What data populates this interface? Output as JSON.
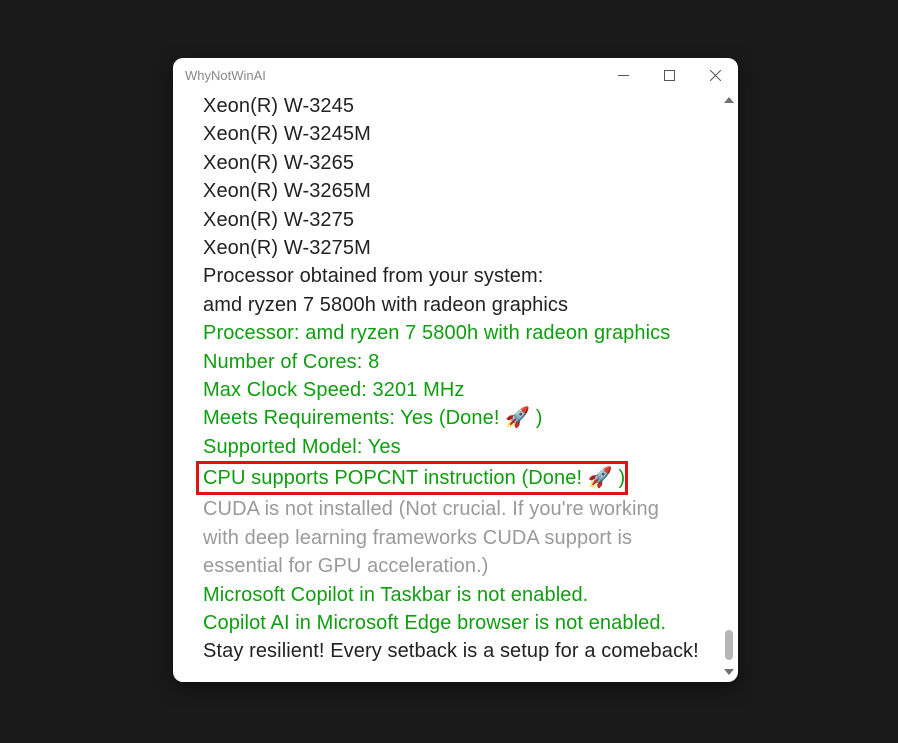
{
  "window": {
    "title": "WhyNotWinAI"
  },
  "lines": [
    {
      "cls": "black",
      "text": "Xeon(R) W-3245"
    },
    {
      "cls": "black",
      "text": "Xeon(R) W-3245M"
    },
    {
      "cls": "black",
      "text": "Xeon(R) W-3265"
    },
    {
      "cls": "black",
      "text": "Xeon(R) W-3265M"
    },
    {
      "cls": "black",
      "text": "Xeon(R) W-3275"
    },
    {
      "cls": "black",
      "text": "Xeon(R) W-3275M"
    },
    {
      "cls": "black",
      "text": "Processor obtained from your system:"
    },
    {
      "cls": "black",
      "text": "amd ryzen 7 5800h with radeon graphics"
    },
    {
      "cls": "green",
      "text": "Processor: amd ryzen 7 5800h with radeon graphics"
    },
    {
      "cls": "green",
      "text": "Number of Cores: 8"
    },
    {
      "cls": "green",
      "text": "Max Clock Speed: 3201 MHz"
    },
    {
      "cls": "green",
      "text": "Meets Requirements: Yes (Done! 🚀 )"
    },
    {
      "cls": "green",
      "text": "Supported Model: Yes"
    }
  ],
  "highlight": {
    "text": "CPU supports POPCNT instruction (Done! 🚀 )"
  },
  "tail": [
    {
      "cls": "gray",
      "text": "CUDA is not installed (Not crucial. If you're working with deep learning frameworks CUDA support is essential for GPU acceleration.)"
    },
    {
      "cls": "green",
      "text": "Microsoft Copilot in Taskbar is not enabled."
    },
    {
      "cls": "green",
      "text": "Copilot AI in Microsoft Edge browser is not enabled."
    },
    {
      "cls": "black",
      "text": "Stay resilient! Every setback is a setup for a comeback!"
    }
  ]
}
